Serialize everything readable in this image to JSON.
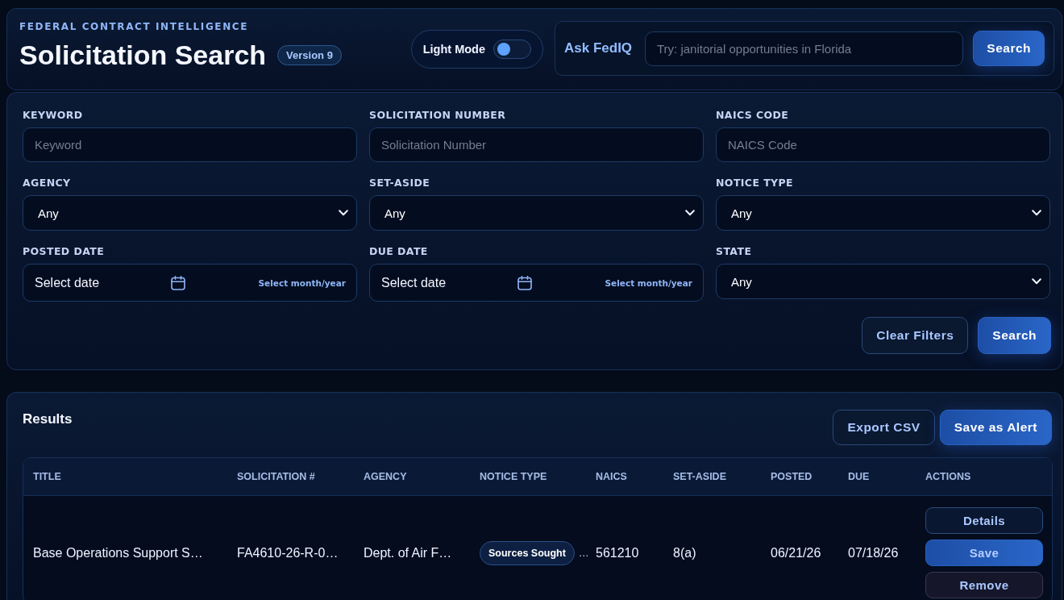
{
  "header": {
    "eyebrow": "FEDERAL CONTRACT INTELLIGENCE",
    "title": "Solicitation Search",
    "version_badge": "Version 9",
    "light_mode_toggle": {
      "label": "Light Mode",
      "on": false
    },
    "ask": {
      "label": "Ask FedIQ",
      "placeholder": "Try: janitorial opportunities in Florida",
      "button": "Search"
    }
  },
  "filters": {
    "fields": [
      {
        "kind": "text",
        "label": "KEYWORD",
        "placeholder": "Keyword"
      },
      {
        "kind": "text",
        "label": "SOLICITATION NUMBER",
        "placeholder": "Solicitation Number"
      },
      {
        "kind": "text",
        "label": "NAICS CODE",
        "placeholder": "NAICS Code"
      },
      {
        "kind": "select",
        "label": "AGENCY",
        "value": "Any"
      },
      {
        "kind": "select",
        "label": "SET-ASIDE",
        "value": "Any"
      },
      {
        "kind": "select",
        "label": "NOTICE TYPE",
        "value": "Any"
      },
      {
        "kind": "date",
        "label": "POSTED DATE",
        "value": "Select date",
        "link": "Select month/year"
      },
      {
        "kind": "date",
        "label": "DUE DATE",
        "value": "Select date",
        "link": "Select month/year"
      },
      {
        "kind": "select",
        "label": "STATE",
        "value": "Any"
      }
    ],
    "buttons": [
      {
        "label": "Clear Filters",
        "kind": "secondary"
      },
      {
        "label": "Search",
        "kind": "primary"
      }
    ]
  },
  "results": {
    "title": "Results",
    "buttons": [
      {
        "label": "Export CSV",
        "kind": "secondary"
      },
      {
        "label": "Save as Alert",
        "kind": "primary"
      }
    ],
    "table": {
      "columns": [
        "TITLE",
        "SOLICITATION #",
        "AGENCY",
        "NOTICE TYPE",
        "NAICS",
        "SET-ASIDE",
        "POSTED",
        "DUE",
        "ACTIONS"
      ],
      "rows": [
        {
          "title": "Base Operations Support S…",
          "solicitation_number": "FA4610-26-R-0…",
          "agency": "Dept. of Air F…",
          "notice_type": {
            "badge": "Sources Sought",
            "overflow": "…"
          },
          "naics": "561210",
          "set_aside": "8(a)",
          "posted": "06/21/26",
          "due": "07/18/26",
          "actions": [
            {
              "label": "Details",
              "kind": "outline"
            },
            {
              "label": "Save",
              "kind": "primary"
            },
            {
              "label": "Remove",
              "kind": "danger"
            }
          ]
        }
      ]
    }
  }
}
